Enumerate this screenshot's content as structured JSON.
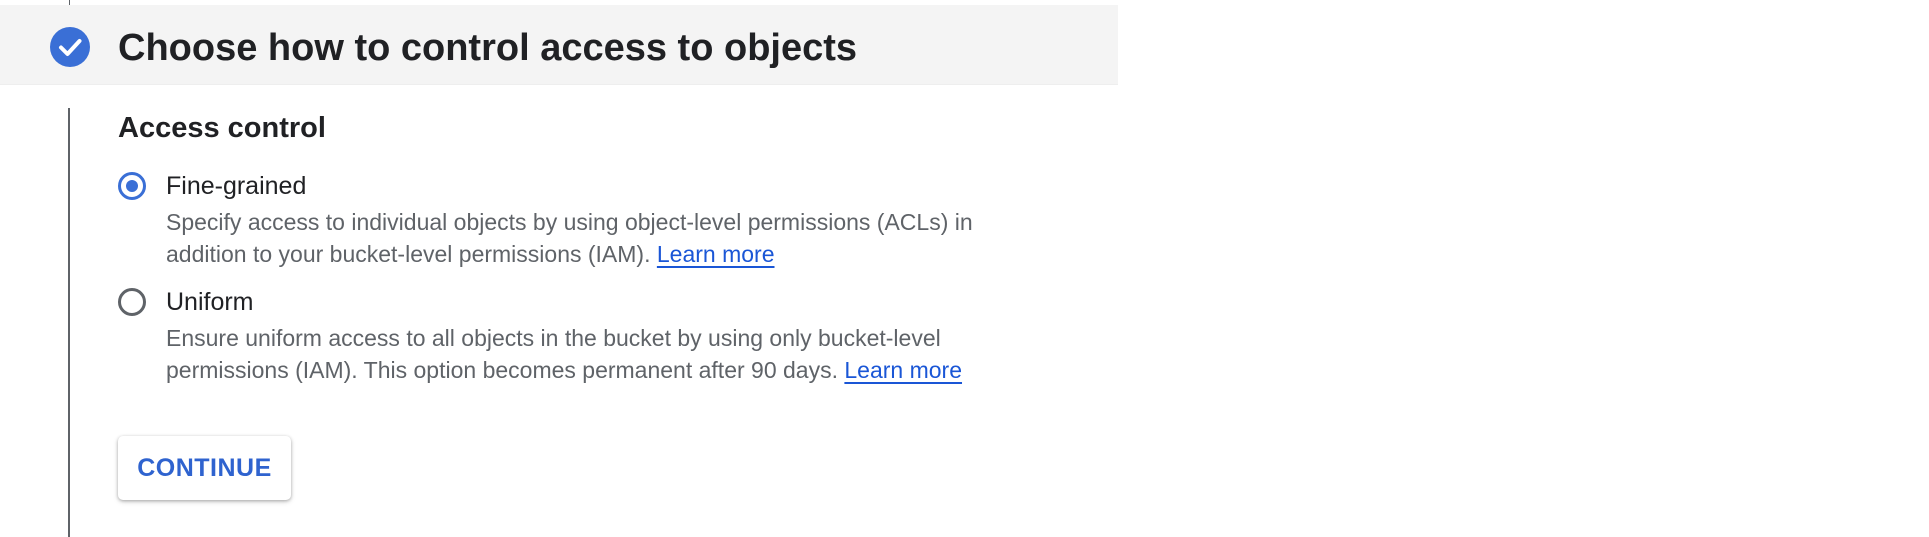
{
  "step": {
    "title": "Choose how to control access to objects",
    "status_icon": "check-circle-icon"
  },
  "access_control": {
    "heading": "Access control",
    "options": [
      {
        "label": "Fine-grained",
        "selected": true,
        "description_lines": [
          "Specify access to individual objects by using object-level permissions (ACLs) in",
          "addition to your bucket-level permissions (IAM)."
        ],
        "link_text": "Learn more"
      },
      {
        "label": "Uniform",
        "selected": false,
        "description_lines": [
          "Ensure uniform access to all objects in the bucket by using only bucket-level",
          "permissions (IAM). This option becomes permanent after 90 days."
        ],
        "link_text": "Learn more"
      }
    ]
  },
  "actions": {
    "continue_label": "CONTINUE"
  },
  "colors": {
    "accent": "#3a6fd6",
    "link": "#1a56d6",
    "header_band": "#f4f4f4",
    "text_primary": "#202124",
    "text_secondary": "#5f6368"
  }
}
